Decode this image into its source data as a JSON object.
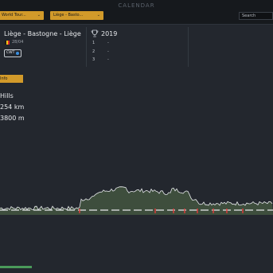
{
  "header": {
    "screen_title": "CALENDAR",
    "dropdowns": [
      {
        "label": "World Tour...",
        "chevron": "⌄"
      },
      {
        "label": "Liège - Basto...",
        "chevron": "⌄"
      }
    ],
    "search": {
      "value": "Search"
    }
  },
  "race": {
    "name": "Liège - Bastogne - Liège",
    "date": "28/04",
    "class_badge": "CWT",
    "flag_colors": [
      "#1b1b1b",
      "#f3c515",
      "#d9262c"
    ]
  },
  "winners": {
    "year": "2019",
    "podium": [
      {
        "rank": "1",
        "name": "-"
      },
      {
        "rank": "2",
        "name": "-"
      },
      {
        "rank": "3",
        "name": "-"
      }
    ]
  },
  "action_button": {
    "label": "Info"
  },
  "stats": {
    "profile_type": "Hills",
    "distance": "254 km",
    "elevation": "3800 m"
  },
  "profile": {
    "area_color": "#56704a",
    "line_color": "#e6e8eb",
    "marker_color": "#e03a3a"
  },
  "colors": {
    "accent": "#d29a2a",
    "background": "#23272e"
  }
}
